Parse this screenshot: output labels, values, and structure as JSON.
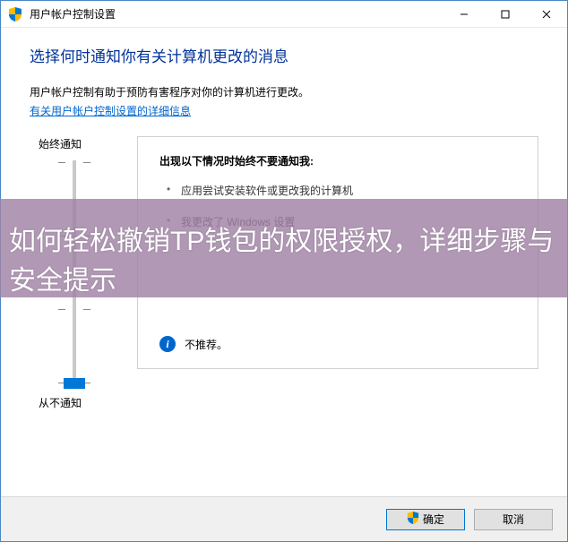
{
  "titlebar": {
    "title": "用户帐户控制设置"
  },
  "heading": "选择何时通知你有关计算机更改的消息",
  "desc": "用户帐户控制有助于预防有害程序对你的计算机进行更改。",
  "link": "有关用户帐户控制设置的详细信息",
  "slider": {
    "top_label": "始终通知",
    "bottom_label": "从不通知"
  },
  "info": {
    "heading": "出现以下情况时始终不要通知我:",
    "items": [
      "应用尝试安装软件或更改我的计算机",
      "我更改了 Windows 设置"
    ],
    "rec": "不推荐。"
  },
  "footer": {
    "ok": "确定",
    "cancel": "取消"
  },
  "overlay": "如何轻松撤销TP钱包的权限授权，详细步骤与安全提示"
}
